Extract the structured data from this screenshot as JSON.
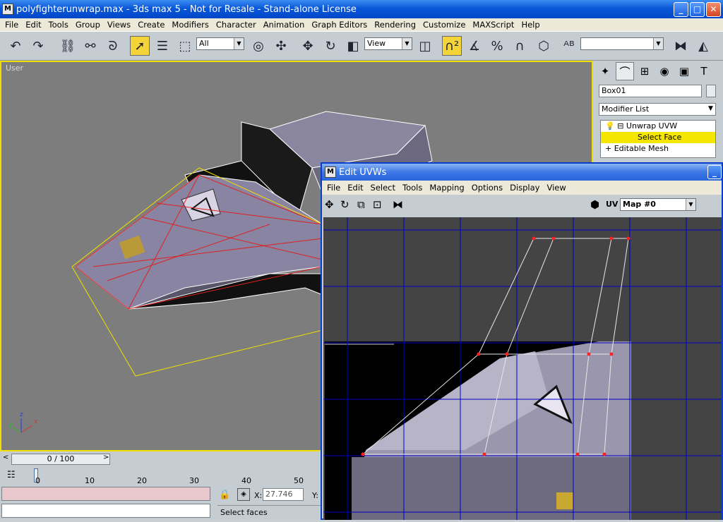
{
  "window": {
    "title": "polyfighterunwrap.max - 3ds max 5 - Not for Resale - Stand-alone License"
  },
  "menu": [
    "File",
    "Edit",
    "Tools",
    "Group",
    "Views",
    "Create",
    "Modifiers",
    "Character",
    "Animation",
    "Graph Editors",
    "Rendering",
    "Customize",
    "MAXScript",
    "Help"
  ],
  "toolbar": {
    "selection_filter": "All",
    "coord_system": "View",
    "named_selection": ""
  },
  "viewport": {
    "label": "User",
    "axis_x": "x",
    "axis_y": "y",
    "axis_z": "z"
  },
  "command_panel": {
    "object_name": "Box01",
    "modifier_list": "Modifier List",
    "stack": [
      {
        "label": "Unwrap UVW",
        "prefix": "⊟"
      },
      {
        "label": "Select Face",
        "prefix": ""
      },
      {
        "label": "Editable Mesh",
        "prefix": "+"
      }
    ]
  },
  "time": {
    "slider": "0 / 100",
    "ticks": [
      "0",
      "10",
      "20",
      "30",
      "40",
      "50"
    ]
  },
  "status": {
    "x_label": "X:",
    "x_value": "27.746",
    "y_label": "Y:",
    "prompt": "Select faces"
  },
  "uv_editor": {
    "title": "Edit UVWs",
    "menu": [
      "File",
      "Edit",
      "Select",
      "Tools",
      "Mapping",
      "Options",
      "Display",
      "View"
    ],
    "uv_label": "UV",
    "map": "Map #0"
  },
  "icons": [
    "undo-icon",
    "redo-icon",
    "link-icon",
    "unlink-icon",
    "bind-icon",
    "select-icon",
    "select-by-name-icon",
    "region-icon",
    "move-icon",
    "rotate-icon",
    "scale-icon",
    "snap-icon",
    "angle-snap-icon",
    "percent-snap-icon",
    "spinner-snap-icon",
    "mirror-icon",
    "align-icon",
    "lock-icon"
  ],
  "colors": {
    "xp_blue": "#0a58d8",
    "selection_yellow": "#f0e000",
    "uv_grid": "#0000c8",
    "vertex_red": "#ff2020"
  }
}
